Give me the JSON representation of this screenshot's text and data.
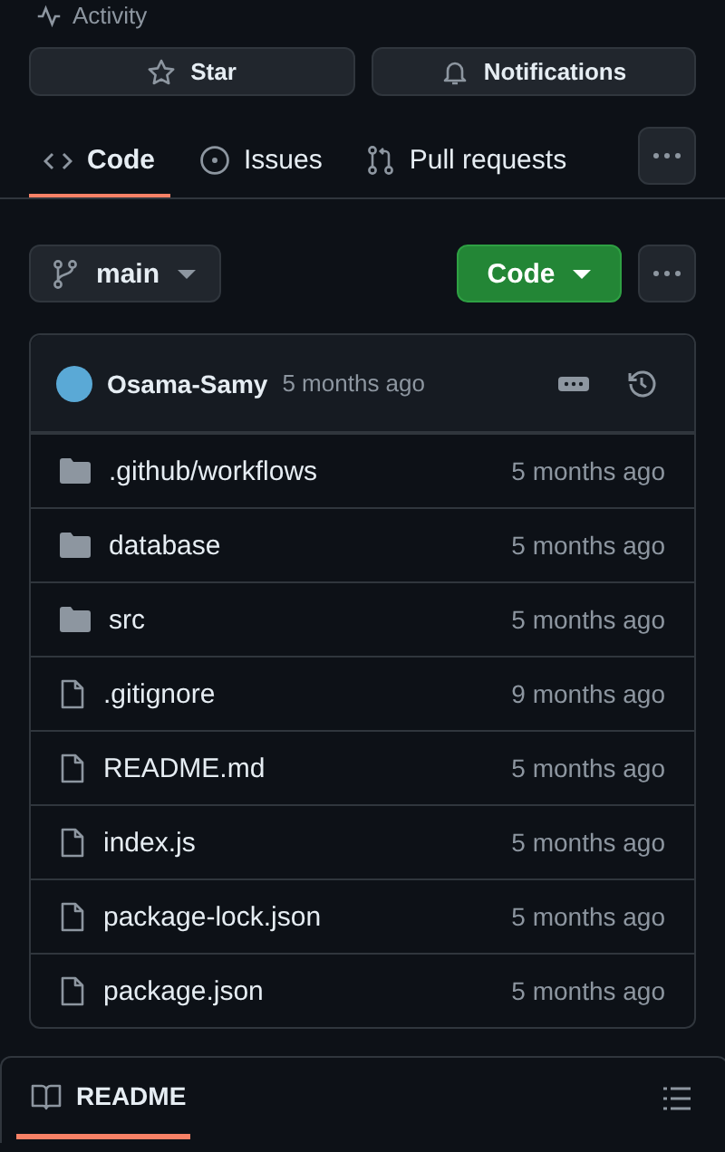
{
  "activity": {
    "label": "Activity"
  },
  "actions": [
    {
      "kind": "star",
      "label": "Star"
    },
    {
      "kind": "bell",
      "label": "Notifications"
    }
  ],
  "tabs": [
    {
      "kind": "code",
      "label": "Code",
      "selected": true
    },
    {
      "kind": "issues",
      "label": "Issues",
      "selected": false
    },
    {
      "kind": "pulls",
      "label": "Pull requests",
      "selected": false
    }
  ],
  "branch": {
    "label": "main"
  },
  "code_button": {
    "label": "Code"
  },
  "commit": {
    "author": "Osama-Samy",
    "time": "5 months ago"
  },
  "files": [
    {
      "kind": "folder",
      "name": ".github/workflows",
      "time": "5 months ago"
    },
    {
      "kind": "folder",
      "name": "database",
      "time": "5 months ago"
    },
    {
      "kind": "folder",
      "name": "src",
      "time": "5 months ago"
    },
    {
      "kind": "file",
      "name": ".gitignore",
      "time": "9 months ago"
    },
    {
      "kind": "file",
      "name": "README.md",
      "time": "5 months ago"
    },
    {
      "kind": "file",
      "name": "index.js",
      "time": "5 months ago"
    },
    {
      "kind": "file",
      "name": "package-lock.json",
      "time": "5 months ago"
    },
    {
      "kind": "file",
      "name": "package.json",
      "time": "5 months ago"
    }
  ],
  "readme": {
    "label": "README",
    "selected": true
  }
}
